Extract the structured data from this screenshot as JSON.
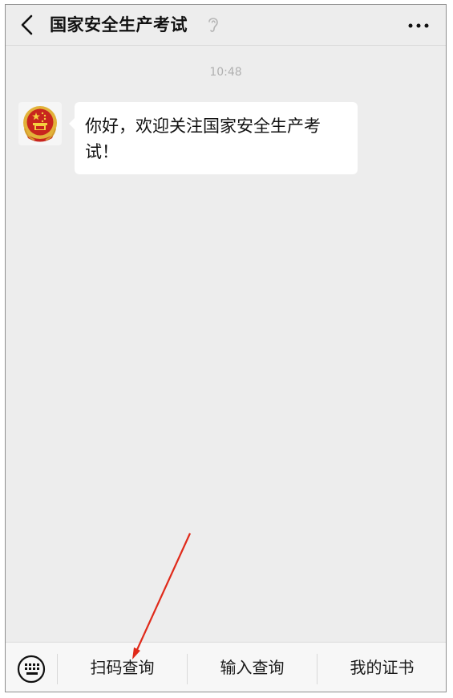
{
  "header": {
    "title": "国家安全生产考试",
    "back_icon": "chevron-left-icon",
    "ear_icon": "ear-icon",
    "more_label": "···"
  },
  "chat": {
    "time": "10:48",
    "messages": [
      {
        "avatar_icon": "national-emblem-icon",
        "text": "你好，欢迎关注国家安全生产考试！"
      }
    ]
  },
  "menu": {
    "keyboard_icon": "keyboard-icon",
    "items": [
      {
        "label": "扫码查询"
      },
      {
        "label": "输入查询"
      },
      {
        "label": "我的证书"
      }
    ]
  },
  "colors": {
    "background": "#ededed",
    "bubble": "#ffffff",
    "annotation_arrow": "#e02a1a",
    "emblem_red": "#c8251e",
    "emblem_gold": "#e2b23a"
  }
}
